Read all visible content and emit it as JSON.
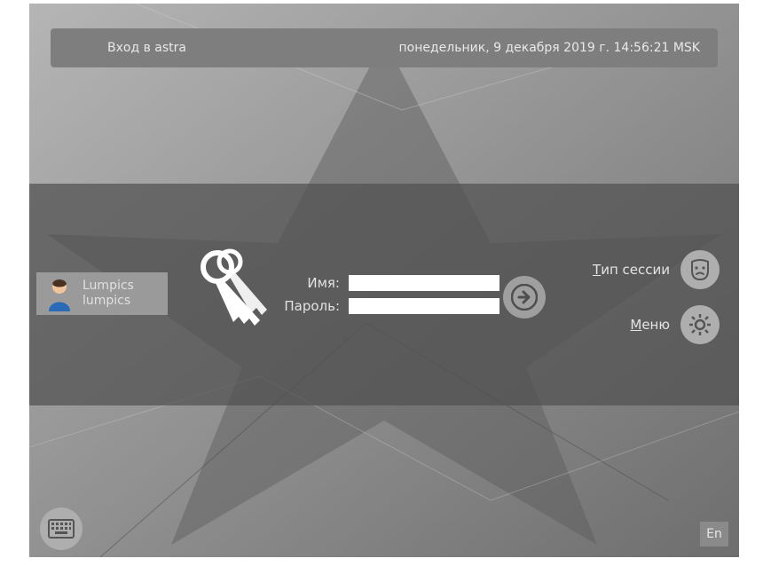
{
  "topbar": {
    "title": "Вход в astra",
    "datetime": "понедельник, 9 декабря 2019 г. 14:56:21 MSK"
  },
  "user": {
    "display_name": "Lumpics",
    "login": "lumpics"
  },
  "form": {
    "name_label": "Имя:",
    "password_label": "Пароль:",
    "name_value": "",
    "password_value": ""
  },
  "right_menu": {
    "session_type_first": "Т",
    "session_type_rest": "ип сессии",
    "menu_first": "М",
    "menu_rest": "еню"
  },
  "lang": "En"
}
